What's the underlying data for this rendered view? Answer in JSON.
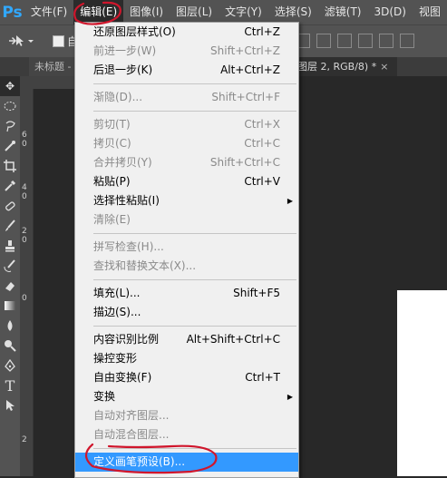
{
  "menubar": {
    "logo": "Ps",
    "items": [
      {
        "label": "文件(F)"
      },
      {
        "label": "编辑(E)",
        "active": true
      },
      {
        "label": "图像(I)"
      },
      {
        "label": "图层(L)"
      },
      {
        "label": "文字(Y)"
      },
      {
        "label": "选择(S)"
      },
      {
        "label": "滤镜(T)"
      },
      {
        "label": "3D(D)"
      },
      {
        "label": "视图"
      }
    ]
  },
  "options_bar": {
    "auto_select_label": "自"
  },
  "tabs": {
    "left_tab": "未标题 -",
    "right_tab": "图层 2, RGB/8) *",
    "close": "×"
  },
  "ruler": {
    "numbers": [
      "6",
      "0",
      "4",
      "0",
      "2",
      "0",
      "0",
      "2"
    ]
  },
  "edit_menu": {
    "items": [
      {
        "type": "item",
        "label": "还原图层样式(O)",
        "shortcut": "Ctrl+Z",
        "disabled": false
      },
      {
        "type": "item",
        "label": "前进一步(W)",
        "shortcut": "Shift+Ctrl+Z",
        "disabled": true
      },
      {
        "type": "item",
        "label": "后退一步(K)",
        "shortcut": "Alt+Ctrl+Z",
        "disabled": false
      },
      {
        "type": "sep"
      },
      {
        "type": "item",
        "label": "渐隐(D)...",
        "shortcut": "Shift+Ctrl+F",
        "disabled": true
      },
      {
        "type": "sep"
      },
      {
        "type": "item",
        "label": "剪切(T)",
        "shortcut": "Ctrl+X",
        "disabled": true
      },
      {
        "type": "item",
        "label": "拷贝(C)",
        "shortcut": "Ctrl+C",
        "disabled": true
      },
      {
        "type": "item",
        "label": "合并拷贝(Y)",
        "shortcut": "Shift+Ctrl+C",
        "disabled": true
      },
      {
        "type": "item",
        "label": "粘贴(P)",
        "shortcut": "Ctrl+V",
        "disabled": false
      },
      {
        "type": "item",
        "label": "选择性粘贴(I)",
        "shortcut": "",
        "disabled": false,
        "submenu": true
      },
      {
        "type": "item",
        "label": "清除(E)",
        "shortcut": "",
        "disabled": true
      },
      {
        "type": "sep"
      },
      {
        "type": "item",
        "label": "拼写检查(H)...",
        "shortcut": "",
        "disabled": true
      },
      {
        "type": "item",
        "label": "查找和替换文本(X)...",
        "shortcut": "",
        "disabled": true
      },
      {
        "type": "sep"
      },
      {
        "type": "item",
        "label": "填充(L)...",
        "shortcut": "Shift+F5",
        "disabled": false
      },
      {
        "type": "item",
        "label": "描边(S)...",
        "shortcut": "",
        "disabled": false
      },
      {
        "type": "sep"
      },
      {
        "type": "item",
        "label": "内容识别比例",
        "shortcut": "Alt+Shift+Ctrl+C",
        "disabled": false
      },
      {
        "type": "item",
        "label": "操控变形",
        "shortcut": "",
        "disabled": false
      },
      {
        "type": "item",
        "label": "自由变换(F)",
        "shortcut": "Ctrl+T",
        "disabled": false
      },
      {
        "type": "item",
        "label": "变换",
        "shortcut": "",
        "disabled": false,
        "submenu": true
      },
      {
        "type": "item",
        "label": "自动对齐图层...",
        "shortcut": "",
        "disabled": true
      },
      {
        "type": "item",
        "label": "自动混合图层...",
        "shortcut": "",
        "disabled": true
      },
      {
        "type": "sep"
      },
      {
        "type": "item",
        "label": "定义画笔预设(B)...",
        "shortcut": "",
        "disabled": false,
        "highlighted": true
      }
    ]
  },
  "colors": {
    "accent_highlight": "#3399ff",
    "annotation_red": "#d0162c"
  }
}
